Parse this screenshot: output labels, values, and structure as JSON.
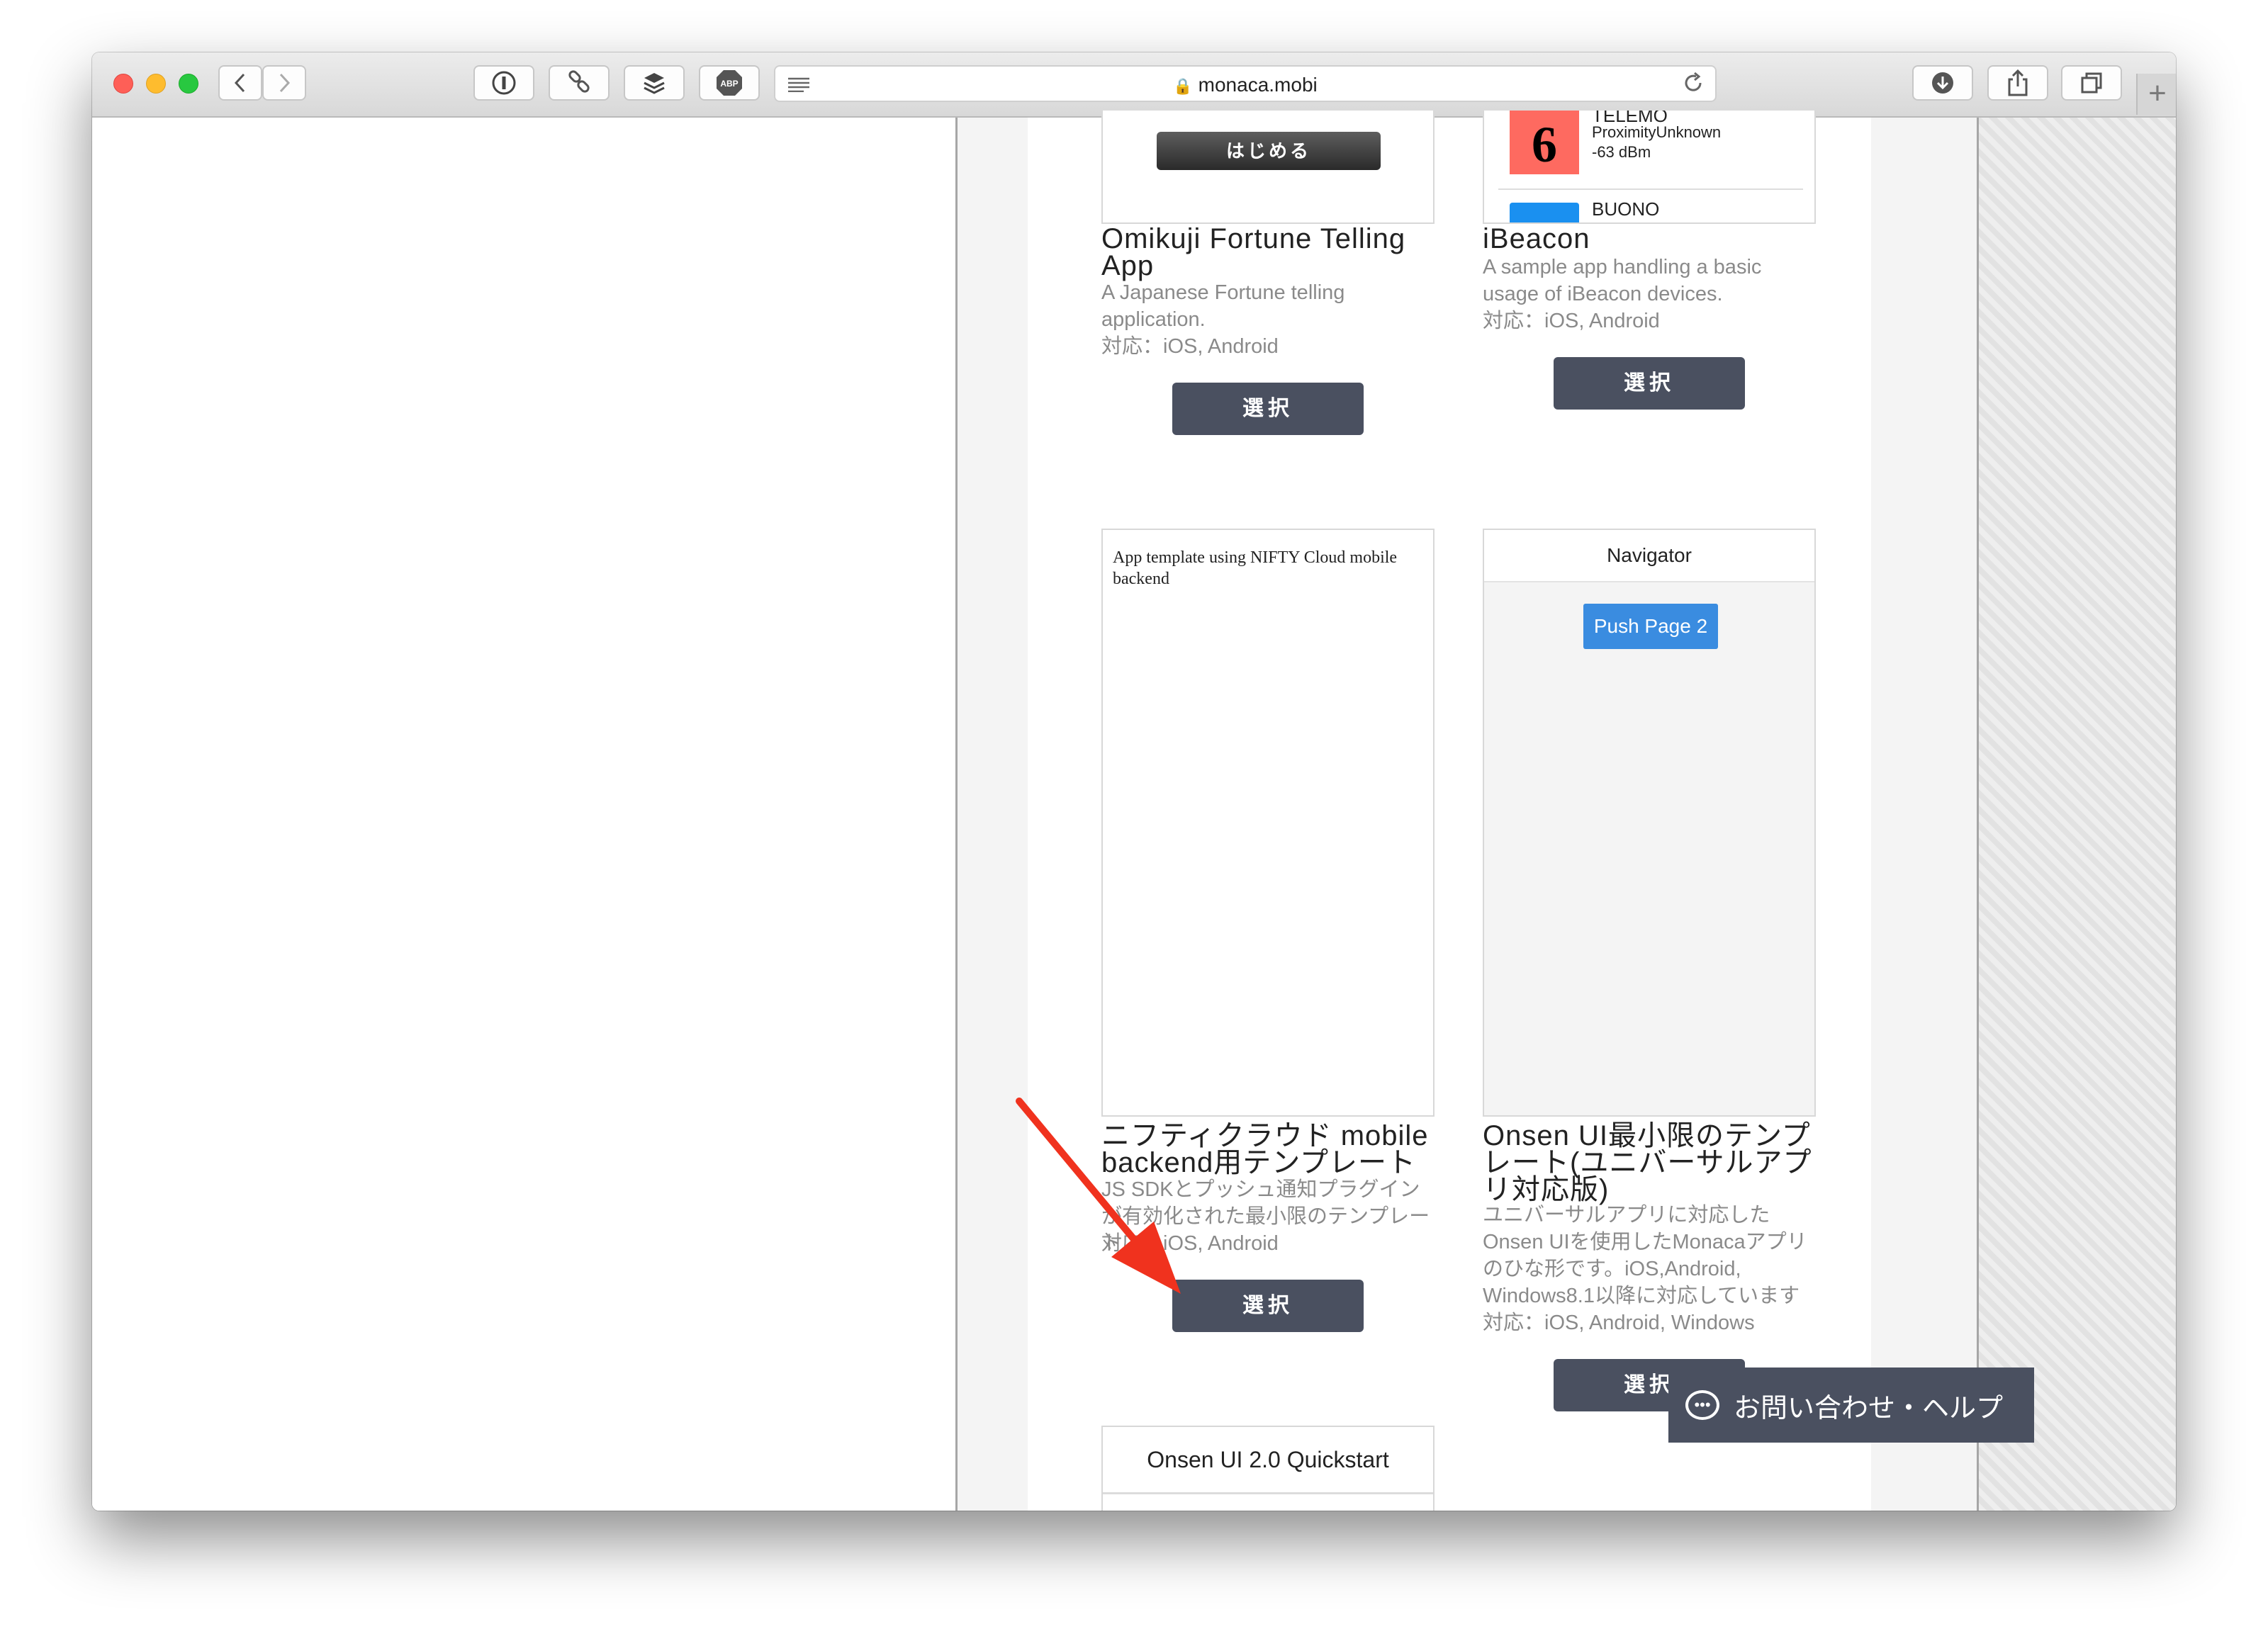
{
  "browser": {
    "url": "monaca.mobi",
    "toolbar_icons": [
      "back-icon",
      "forward-icon",
      "onepassword-icon",
      "link-icon",
      "buffer-icon",
      "adblock-icon",
      "reader-icon",
      "download-icon",
      "share-icon",
      "tabs-icon"
    ],
    "adblock_label": "ABP",
    "new_tab_label": "+"
  },
  "cards": [
    {
      "title": "Omikuji Fortune Telling App",
      "desc": "A Japanese Fortune telling application.",
      "support": "対応：iOS, Android",
      "thumb_button": "はじめる",
      "select_label": "選択"
    },
    {
      "title": "iBeacon",
      "desc": "A sample app handling a basic usage of iBeacon devices.",
      "support": "対応：iOS, Android",
      "beacon_number": "6",
      "beacon_name_1": "TELEMO",
      "beacon_proximity": "ProximityUnknown",
      "beacon_rssi": "-63 dBm",
      "beacon_name_2": "BUONO",
      "select_label": "選択"
    },
    {
      "title": "ニフティクラウド mobile backend用テンプレート",
      "desc": "JS SDKとプッシュ通知プラグインが有効化された最小限のテンプレート",
      "support": "対応：iOS, Android",
      "thumb_text": "App template using NIFTY Cloud mobile backend",
      "select_label": "選択"
    },
    {
      "title": "Onsen UI最小限のテンプレート(ユニバーサルアプリ対応版)",
      "desc": "ユニバーサルアプリに対応したOnsen UIを使用したMonacaアプリのひな形です。iOS,Android, Windows8.1以降に対応しています",
      "support": "対応：iOS, Android, Windows",
      "thumb_header": "Navigator",
      "thumb_button": "Push Page 2",
      "select_label": "選択"
    },
    {
      "thumb_header": "Onsen UI 2.0 Quickstart"
    }
  ],
  "help_button": {
    "label": "お問い合わせ・ヘルプ",
    "icon_glyph": "•••"
  },
  "colors": {
    "select_button": "#4a5060",
    "arrow": "#f0321e",
    "push_button": "#3a8ce0",
    "beacon_red": "#fe6a60",
    "beacon_blue": "#1a90f0"
  }
}
